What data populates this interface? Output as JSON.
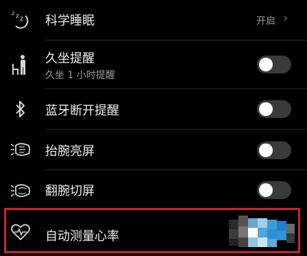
{
  "settings": [
    {
      "id": "sleep",
      "icon": "sleep-zzz-icon",
      "label": "科学睡眠",
      "value": "开启",
      "control": "link"
    },
    {
      "id": "sedentary",
      "icon": "sedentary-person-icon",
      "label": "久坐提醒",
      "sublabel": "久坐 1 小时提醒",
      "control": "toggle",
      "on": false
    },
    {
      "id": "bluetooth",
      "icon": "bluetooth-icon",
      "label": "蓝牙断开提醒",
      "control": "toggle",
      "on": false
    },
    {
      "id": "raise-wrist",
      "icon": "raise-wrist-icon",
      "label": "抬腕亮屏",
      "control": "toggle",
      "on": false
    },
    {
      "id": "flip-wrist",
      "icon": "flip-wrist-icon",
      "label": "翻腕切屏",
      "control": "toggle",
      "on": false
    },
    {
      "id": "heart-rate",
      "icon": "heart-rate-icon",
      "label": "自动测量心率",
      "control": "toggle-obscured",
      "highlighted": true
    }
  ],
  "colors": {
    "background": "#000000",
    "text": "#ececec",
    "secondary_text": "#9a9a9a",
    "toggle_off": "#3a3a3a",
    "highlight_border": "#d0232b"
  }
}
